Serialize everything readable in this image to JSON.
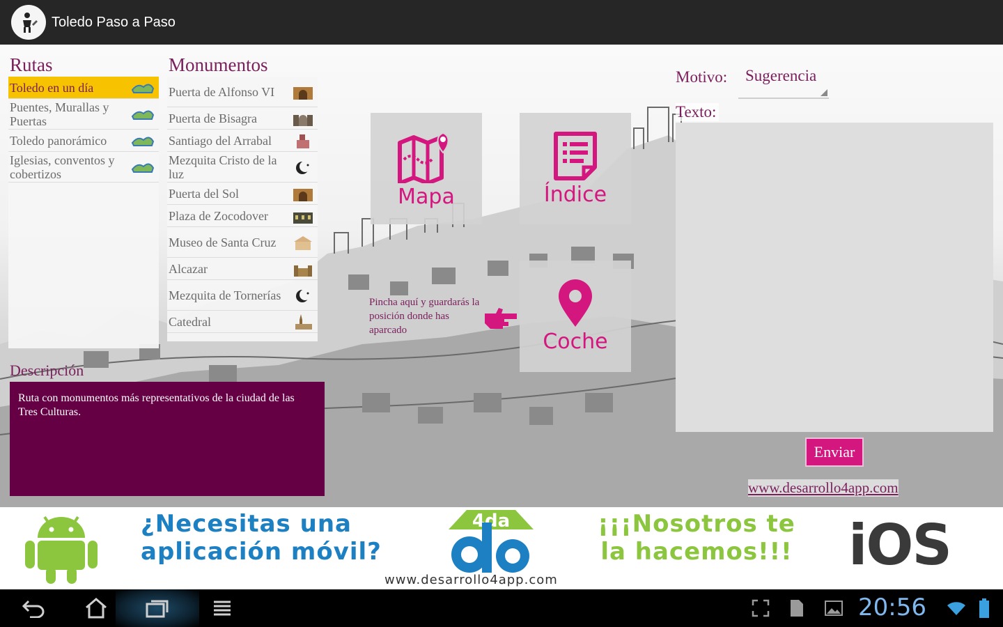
{
  "app": {
    "title": "Toledo Paso a Paso"
  },
  "rutas": {
    "title": "Rutas",
    "items": [
      {
        "label": "Toledo en un día",
        "selected": true
      },
      {
        "label": "Puentes, Murallas y Puertas",
        "selected": false
      },
      {
        "label": "Toledo panorámico",
        "selected": false
      },
      {
        "label": "Iglesias, conventos y cobertizos",
        "selected": false
      }
    ]
  },
  "monumentos": {
    "title": "Monumentos",
    "items": [
      {
        "label": "Puerta de Alfonso VI",
        "icon": "gate-icon"
      },
      {
        "label": "Puerta de Bisagra",
        "icon": "gate-icon"
      },
      {
        "label": "Santiago del Arrabal",
        "icon": "church-icon"
      },
      {
        "label": "Mezquita Cristo de la luz",
        "icon": "crescent-icon"
      },
      {
        "label": "Puerta del Sol",
        "icon": "gate-icon"
      },
      {
        "label": "Plaza de Zocodover",
        "icon": "plaza-icon"
      },
      {
        "label": "Museo de Santa Cruz",
        "icon": "museum-icon"
      },
      {
        "label": "Alcazar",
        "icon": "castle-icon"
      },
      {
        "label": "Mezquita de Tornerías",
        "icon": "crescent-icon"
      },
      {
        "label": "Catedral",
        "icon": "cathedral-icon"
      }
    ]
  },
  "description": {
    "title": "Descripción",
    "text": "Ruta con monumentos más representativos de la ciudad de las Tres Culturas."
  },
  "tiles": {
    "mapa": "Mapa",
    "indice": "Índice",
    "coche": "Coche"
  },
  "hint": {
    "text": "Pincha aquí y guardarás la posición donde has aparcado"
  },
  "form": {
    "motivo_label": "Motivo:",
    "motivo_value": "Sugerencia",
    "texto_label": "Texto:",
    "texto_value": "",
    "send_label": "Enviar"
  },
  "link": {
    "text": "www.desarrollo4app.com"
  },
  "ad": {
    "question": "¿Necesitas una aplicación móvil?",
    "answer": "¡¡¡Nosotros te la hacemos!!!",
    "url": "www.desarrollo4app.com",
    "ios": "iOS",
    "logo_text": "4da"
  },
  "status": {
    "time": "20:56"
  },
  "colors": {
    "accent": "#d4167f",
    "brand_purple": "#650045",
    "title_purple": "#7a1f5c",
    "selected": "#f7c200",
    "titlebar": "#262626"
  }
}
